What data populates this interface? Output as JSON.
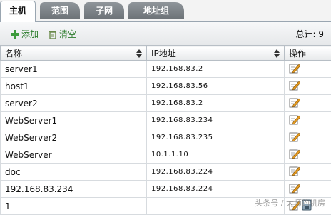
{
  "tabs": [
    {
      "label": "主机",
      "active": true
    },
    {
      "label": "范围",
      "active": false
    },
    {
      "label": "子网",
      "active": false
    },
    {
      "label": "地址组",
      "active": false
    }
  ],
  "toolbar": {
    "add_label": "添加",
    "clear_label": "清空",
    "total_text": "总计: 9"
  },
  "table": {
    "columns": [
      "名称",
      "IP地址",
      "操作"
    ],
    "rows": [
      {
        "name": "server1",
        "ip": "192.168.83.2"
      },
      {
        "name": "host1",
        "ip": "192.168.83.56"
      },
      {
        "name": "server2",
        "ip": "192.168.83.2"
      },
      {
        "name": "WebServer1",
        "ip": "192.168.83.234"
      },
      {
        "name": "WebServer2",
        "ip": "192.168.83.235"
      },
      {
        "name": "WebServer",
        "ip": "10.1.1.10"
      },
      {
        "name": "doc",
        "ip": "192.168.83.224"
      },
      {
        "name": "192.168.83.234",
        "ip": "192.168.83.224"
      },
      {
        "name": "1",
        "ip": ""
      }
    ]
  },
  "icons": {
    "edit": "edit-icon",
    "save": "save-icon",
    "add": "plus-icon",
    "clear": "trash-icon"
  },
  "colors": {
    "tab_inactive": "#7b8186",
    "toolbar_text": "#2e7d2e",
    "edit_orange": "#e59a1e"
  },
  "watermark": "头条号 / 大师的机房"
}
